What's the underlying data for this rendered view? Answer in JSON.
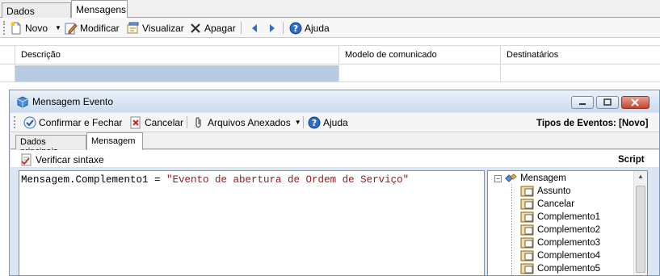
{
  "outer_tabs": [
    "Dados principais",
    "Mensagens"
  ],
  "main_toolbar": {
    "novo": "Novo",
    "modificar": "Modificar",
    "visualizar": "Visualizar",
    "apagar": "Apagar",
    "ajuda": "Ajuda"
  },
  "grid": {
    "columns": [
      "Descrição",
      "Modelo de comunicado",
      "Destinatários"
    ]
  },
  "dialog": {
    "title": "Mensagem Evento",
    "toolbar": {
      "confirmar": "Confirmar e Fechar",
      "cancelar": "Cancelar",
      "arquivos": "Arquivos Anexados",
      "ajuda": "Ajuda",
      "tipos": "Tipos de Eventos: [Novo]"
    },
    "tabs": [
      "Dados principais",
      "Mensagem"
    ],
    "verificar": "Verificar sintaxe",
    "script_label": "Script",
    "editor": {
      "code_prefix": "Mensagem.Complemento1 = ",
      "code_string": "\"Evento de abertura de Ordem de Serviço\""
    },
    "tree": {
      "root": "Mensagem",
      "items": [
        "Assunto",
        "Cancelar",
        "Complemento1",
        "Complemento2",
        "Complemento3",
        "Complemento4",
        "Complemento5"
      ]
    }
  },
  "colors": {
    "selected_cell": "#b7c9e3",
    "string_literal": "#a31515",
    "title_gradient_top": "#eaf1f9"
  }
}
